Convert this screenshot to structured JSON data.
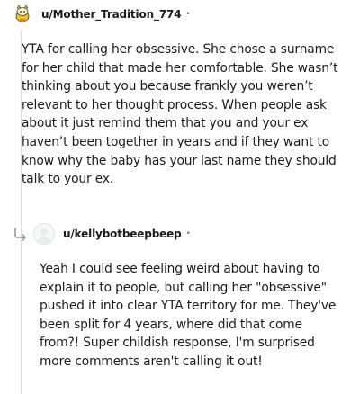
{
  "comments": [
    {
      "username": "u/Mother_Tradition_774",
      "separator": "•",
      "body": "YTA for calling her obsessive. She chose a surname\nfor her child that made her comfortable. She wasn’t\nthinking about you because frankly you weren’t\nrelevant to her thought process. When people ask\nabout it just remind them that you and your ex\nhaven’t been together in years and if they want to\nknow why the baby has your last name they should\ntalk to your ex."
    },
    {
      "username": "u/kellybotbeepbeep",
      "separator": "•",
      "body": "Yeah I could see feeling weird about having to\nexplain it to people, but calling her \"obsessive\"\npushed it into clear YTA territory for me. They've\nbeen split for 4 years, where did that come\nfrom?! Super childish response, I'm surprised\nmore comments aren't calling it out!"
    }
  ],
  "icons": {
    "avatar1": "snoo-avatar-icon",
    "reply": "reply-arrow-icon",
    "avatar2": "default-avatar-icon"
  },
  "colors": {
    "text": "#1c1c1c",
    "thread_line": "#dcdcdc",
    "accent_yellow": "#f5c518"
  }
}
